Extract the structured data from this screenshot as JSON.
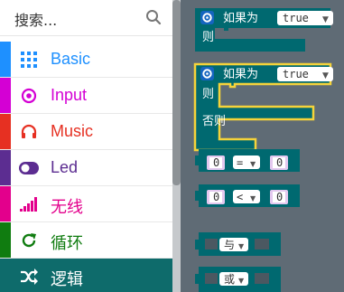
{
  "search": {
    "placeholder": "搜索..."
  },
  "categories": [
    {
      "label": "Basic",
      "color": "#1e90ff",
      "icon": "grid-icon"
    },
    {
      "label": "Input",
      "color": "#d400d4",
      "icon": "target-icon"
    },
    {
      "label": "Music",
      "color": "#e63022",
      "icon": "headphones-icon"
    },
    {
      "label": "Led",
      "color": "#5c2d91",
      "icon": "toggle-icon"
    },
    {
      "label": "无线",
      "color": "#e3008c",
      "icon": "signal-icon"
    },
    {
      "label": "循环",
      "color": "#107c10",
      "icon": "refresh-icon"
    },
    {
      "label": "逻辑",
      "color": "#00a4a6",
      "icon": "shuffle-icon"
    }
  ],
  "blocks": {
    "if1": {
      "if_label": "如果为",
      "value": "true",
      "then_label": "则"
    },
    "if2": {
      "if_label": "如果为",
      "value": "true",
      "then_label": "则",
      "else_label": "否则"
    },
    "eq": {
      "left": "0",
      "op": "=",
      "right": "0"
    },
    "lt": {
      "left": "0",
      "op": "<",
      "right": "0"
    },
    "and": {
      "op": "与"
    },
    "or": {
      "op": "或"
    }
  },
  "colors": {
    "logic_block": "#006970",
    "flyout_bg": "#5f6b75",
    "selected_category": "#0e6b6b",
    "highlight": "#f5d33a"
  }
}
